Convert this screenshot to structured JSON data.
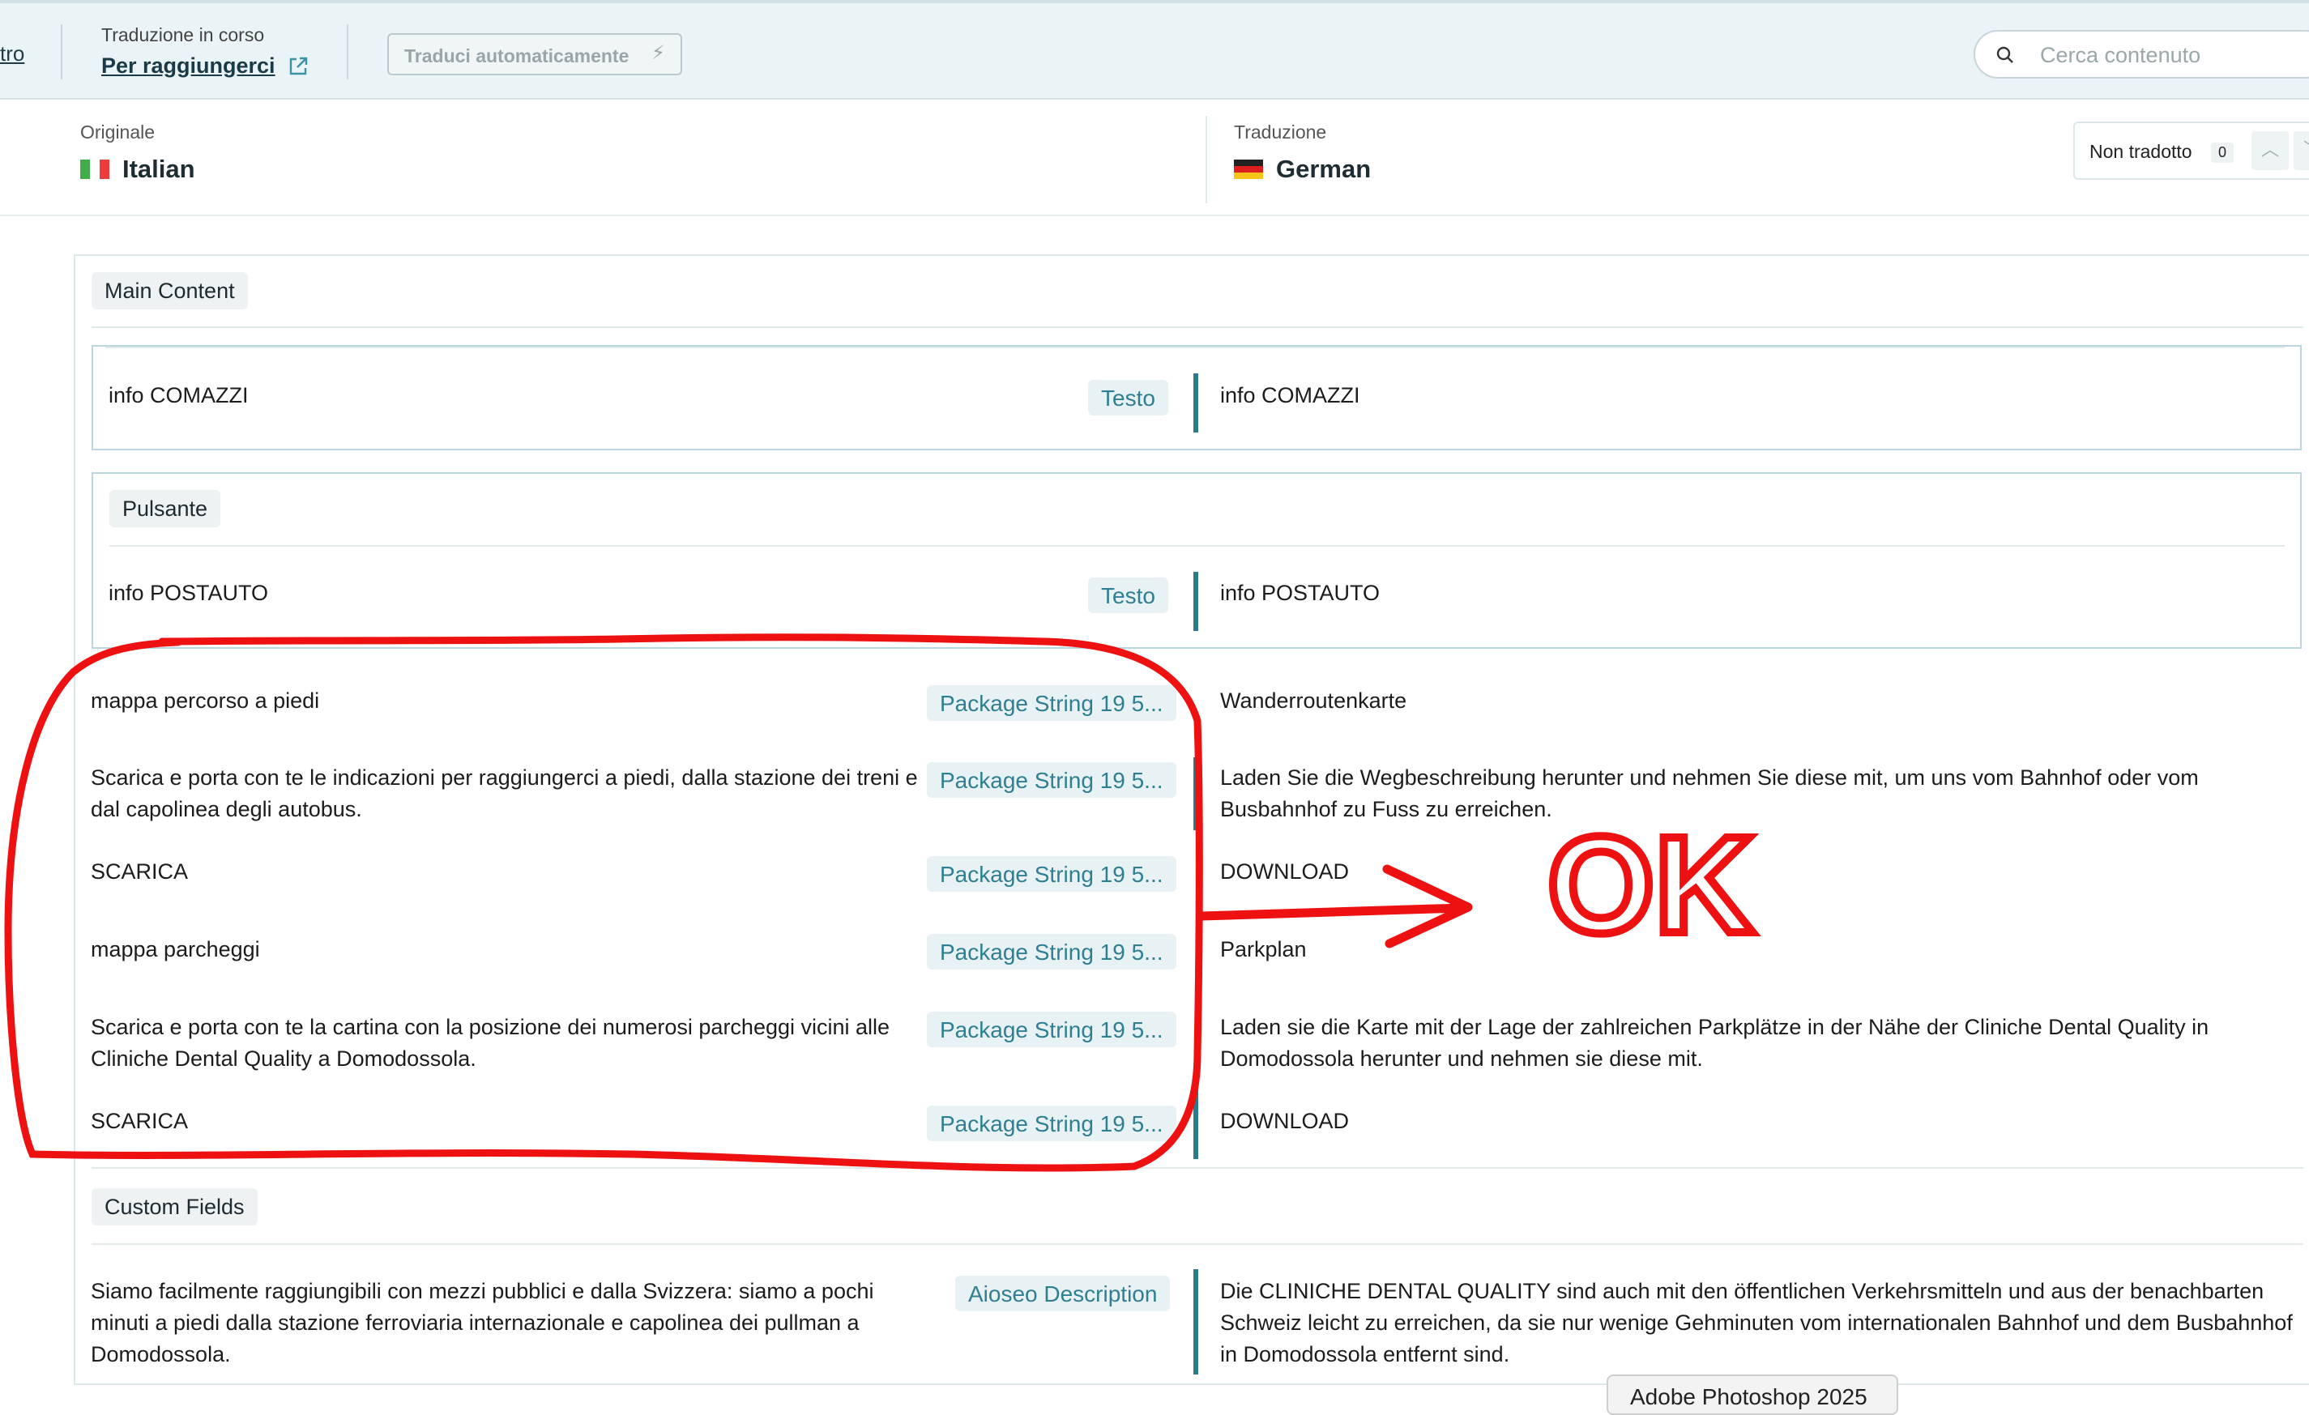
{
  "toolbar": {
    "back_link": "tro",
    "status_label": "Traduzione in corso",
    "page_link": "Per raggiungerci",
    "auto_translate_label": "Traduci automaticamente",
    "search_placeholder": "Cerca contenuto"
  },
  "languages": {
    "original_label": "Originale",
    "original_name": "Italian",
    "translation_label": "Traduzione",
    "translation_name": "German"
  },
  "filter": {
    "label": "Non tradotto",
    "count": "0"
  },
  "sections": {
    "main_content": "Main Content",
    "pulsante": "Pulsante",
    "custom_fields": "Custom Fields"
  },
  "rows": [
    {
      "source": "info COMAZZI",
      "badge": "Testo",
      "target": "info COMAZZI"
    },
    {
      "source": "info POSTAUTO",
      "badge": "Testo",
      "target": "info POSTAUTO"
    },
    {
      "source": "mappa percorso a piedi",
      "badge": "Package String 19 5...",
      "target": "Wanderroutenkarte"
    },
    {
      "source": "Scarica e porta con te le indicazioni per raggiungerci a piedi, dalla stazione dei treni e dal capolinea degli autobus.",
      "badge": "Package String 19 5...",
      "target": "Laden Sie die Wegbeschreibung herunter und nehmen Sie diese mit, um uns vom Bahnhof oder vom Busbahnhof zu Fuss zu erreichen."
    },
    {
      "source": "SCARICA",
      "badge": "Package String 19 5...",
      "target": "DOWNLOAD"
    },
    {
      "source": "mappa parcheggi",
      "badge": "Package String 19 5...",
      "target": "Parkplan"
    },
    {
      "source": "Scarica e porta con te la cartina con la posizione dei numerosi parcheggi vicini alle Cliniche Dental Quality a Domodossola.",
      "badge": "Package String 19 5...",
      "target": "Laden sie die Karte mit der Lage der zahlreichen Parkplätze in der Nähe der Cliniche Dental Quality in Domodossola herunter und nehmen sie diese mit."
    },
    {
      "source": "SCARICA",
      "badge": "Package String 19 5...",
      "target": "DOWNLOAD"
    },
    {
      "source": "Siamo facilmente raggiungibili con mezzi pubblici e dalla Svizzera: siamo a pochi minuti a piedi dalla stazione ferroviaria internazionale e capolinea dei pullman a Domodossola.",
      "badge": "Aioseo Description",
      "target": "Die CLINICHE DENTAL QUALITY sind auch mit den öffentlichen Verkehrsmitteln und aus der benachbarten Schweiz leicht zu erreichen, da sie nur wenige Gehminuten vom internationalen Bahnhof und dem Busbahnhof in Domodossola entfernt sind."
    }
  ],
  "annotation": {
    "text": "OK",
    "color": "#ee1111"
  },
  "tooltip": "Adobe Photoshop 2025",
  "colors": {
    "accent": "#2c7b8d",
    "toolbar_bg": "#eaf3f5",
    "annotation": "#ee1111"
  }
}
